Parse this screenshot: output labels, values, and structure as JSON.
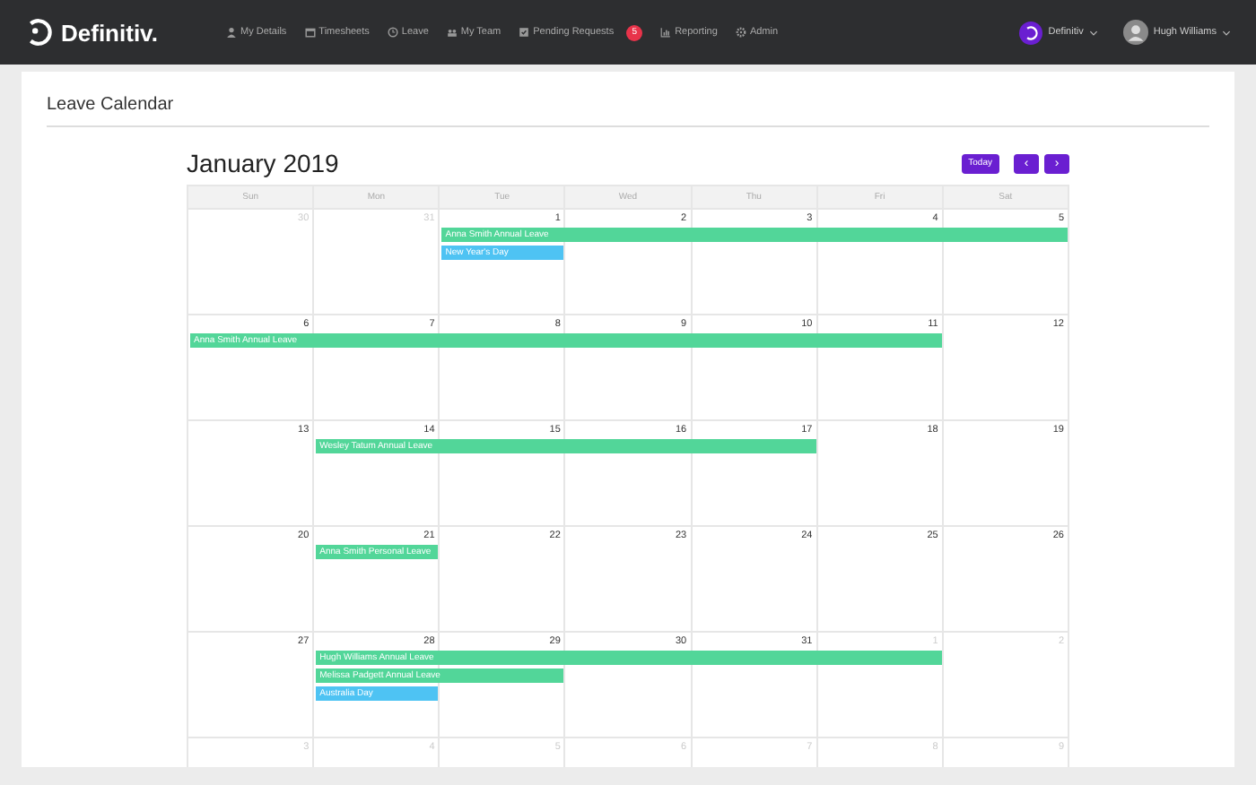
{
  "navbar": {
    "brand": "Definitiv.",
    "items": [
      {
        "label": "My Details"
      },
      {
        "label": "Timesheets"
      },
      {
        "label": "Leave"
      },
      {
        "label": "My Team"
      },
      {
        "label": "Pending Requests",
        "badge": "5"
      },
      {
        "label": "Reporting"
      },
      {
        "label": "Admin"
      }
    ],
    "company": "Definitiv",
    "user": "Hugh Williams"
  },
  "page_title": "Leave Calendar",
  "calendar": {
    "title": "January 2019",
    "today_button": "Today",
    "prev_button": "‹",
    "next_button": "›",
    "weekdays": [
      "Sun",
      "Mon",
      "Tue",
      "Wed",
      "Thu",
      "Fri",
      "Sat"
    ],
    "weeks": [
      {
        "days": [
          {
            "number": "30",
            "other_month": true
          },
          {
            "number": "31",
            "other_month": true
          },
          {
            "number": "1",
            "other_month": false
          },
          {
            "number": "2",
            "other_month": false
          },
          {
            "number": "3",
            "other_month": false
          },
          {
            "number": "4",
            "other_month": false
          },
          {
            "number": "5",
            "other_month": false
          }
        ],
        "events": [
          {
            "title": "Anna Smith Annual Leave",
            "color": "#52d699"
          },
          {
            "title": "New Year's Day",
            "color": "#4ec3f3"
          }
        ]
      },
      {
        "days": [
          {
            "number": "6",
            "other_month": false
          },
          {
            "number": "7",
            "other_month": false
          },
          {
            "number": "8",
            "other_month": false
          },
          {
            "number": "9",
            "other_month": false
          },
          {
            "number": "10",
            "other_month": false
          },
          {
            "number": "11",
            "other_month": false
          },
          {
            "number": "12",
            "other_month": false
          }
        ],
        "events": [
          {
            "title": "Anna Smith Annual Leave",
            "color": "#52d699"
          }
        ]
      },
      {
        "days": [
          {
            "number": "13",
            "other_month": false
          },
          {
            "number": "14",
            "other_month": false
          },
          {
            "number": "15",
            "other_month": false
          },
          {
            "number": "16",
            "other_month": false
          },
          {
            "number": "17",
            "other_month": false
          },
          {
            "number": "18",
            "other_month": false
          },
          {
            "number": "19",
            "other_month": false
          }
        ],
        "events": [
          {
            "title": "Wesley Tatum Annual Leave",
            "color": "#52d699"
          }
        ]
      },
      {
        "days": [
          {
            "number": "20",
            "other_month": false
          },
          {
            "number": "21",
            "other_month": false
          },
          {
            "number": "22",
            "other_month": false
          },
          {
            "number": "23",
            "other_month": false
          },
          {
            "number": "24",
            "other_month": false
          },
          {
            "number": "25",
            "other_month": false
          },
          {
            "number": "26",
            "other_month": false
          }
        ],
        "events": [
          {
            "title": "Anna Smith Personal Leave",
            "color": "#52d699"
          }
        ]
      },
      {
        "days": [
          {
            "number": "27",
            "other_month": false
          },
          {
            "number": "28",
            "other_month": false
          },
          {
            "number": "29",
            "other_month": false
          },
          {
            "number": "30",
            "other_month": false
          },
          {
            "number": "31",
            "other_month": false
          },
          {
            "number": "1",
            "other_month": true
          },
          {
            "number": "2",
            "other_month": true
          }
        ],
        "events": [
          {
            "title": "Hugh Williams Annual Leave",
            "color": "#52d699"
          },
          {
            "title": "Melissa Padgett Annual Leave",
            "color": "#52d699"
          },
          {
            "title": "Australia Day",
            "color": "#4ec3f3"
          }
        ]
      },
      {
        "days": [
          {
            "number": "3",
            "other_month": true
          },
          {
            "number": "4",
            "other_month": true
          },
          {
            "number": "5",
            "other_month": true
          },
          {
            "number": "6",
            "other_month": true
          },
          {
            "number": "7",
            "other_month": true
          },
          {
            "number": "8",
            "other_month": true
          },
          {
            "number": "9",
            "other_month": true
          }
        ]
      }
    ]
  }
}
